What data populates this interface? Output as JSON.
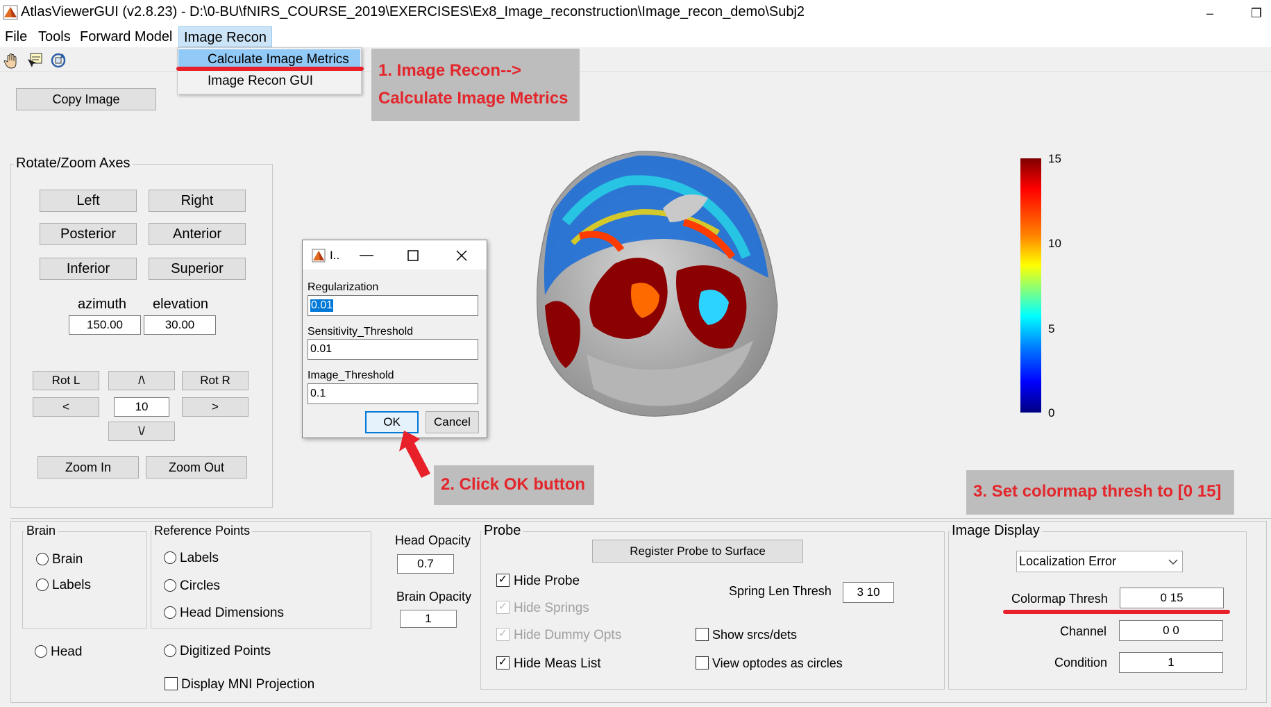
{
  "window": {
    "title": "AtlasViewerGUI  (v2.8.23) - D:\\0-BU\\fNIRS_COURSE_2019\\EXERCISES\\Ex8_Image_reconstruction\\Image_recon_demo\\Subj2",
    "minimize": "–",
    "maximize": "❐"
  },
  "menu": {
    "items": [
      "File",
      "Tools",
      "Forward Model",
      "Image Recon"
    ],
    "dropdown": [
      "Calculate Image Metrics",
      "Image Recon GUI"
    ]
  },
  "annotations": {
    "step1_line1": "1. Image Recon-->",
    "step1_line2": "Calculate Image Metrics",
    "step2": "2. Click OK button",
    "step3": "3. Set colormap thresh to [0 15]"
  },
  "copy_image": "Copy Image",
  "rotate_zoom": {
    "title": "Rotate/Zoom Axes",
    "left": "Left",
    "right": "Right",
    "posterior": "Posterior",
    "anterior": "Anterior",
    "inferior": "Inferior",
    "superior": "Superior",
    "azimuth_label": "azimuth",
    "elevation_label": "elevation",
    "azimuth": "150.00",
    "elevation": "30.00",
    "rot_l": "Rot L",
    "up": "/\\",
    "rot_r": "Rot R",
    "prev": "<",
    "step": "10",
    "next": ">",
    "down": "\\/",
    "zoom_in": "Zoom In",
    "zoom_out": "Zoom Out"
  },
  "dialog": {
    "title": "I..",
    "reg_label": "Regularization",
    "reg_value": "0.01",
    "sens_label": "Sensitivity_Threshold",
    "sens_value": "0.01",
    "img_label": "Image_Threshold",
    "img_value": "0.1",
    "ok": "OK",
    "cancel": "Cancel"
  },
  "colorbar": {
    "ticks": [
      "15",
      "10",
      "5",
      "0"
    ],
    "top_color": "#800000",
    "bottom_color": "#000080"
  },
  "brain_panel": {
    "title": "Brain",
    "opt_brain": "Brain",
    "opt_labels": "Labels",
    "opt_head": "Head"
  },
  "ref_points": {
    "title": "Reference Points",
    "labels": "Labels",
    "circles": "Circles",
    "head_dims": "Head Dimensions",
    "digitized": "Digitized Points",
    "mni": "Display MNI Projection"
  },
  "opacity": {
    "head_label": "Head Opacity",
    "head_value": "0.7",
    "brain_label": "Brain Opacity",
    "brain_value": "1"
  },
  "probe": {
    "title": "Probe",
    "register": "Register Probe to Surface",
    "hide_probe": "Hide Probe",
    "hide_springs": "Hide Springs",
    "hide_dummy": "Hide Dummy Opts",
    "hide_meas": "Hide Meas List",
    "spring_label": "Spring Len Thresh",
    "spring_value": "3  10",
    "show_srcs": "Show srcs/dets",
    "view_circles": "View optodes as circles"
  },
  "image_display": {
    "title": "Image Display",
    "selected": "Localization Error",
    "colormap_label": "Colormap Thresh",
    "colormap_value": "0 15",
    "channel_label": "Channel",
    "channel_value": "0 0",
    "condition_label": "Condition",
    "condition_value": "1"
  }
}
